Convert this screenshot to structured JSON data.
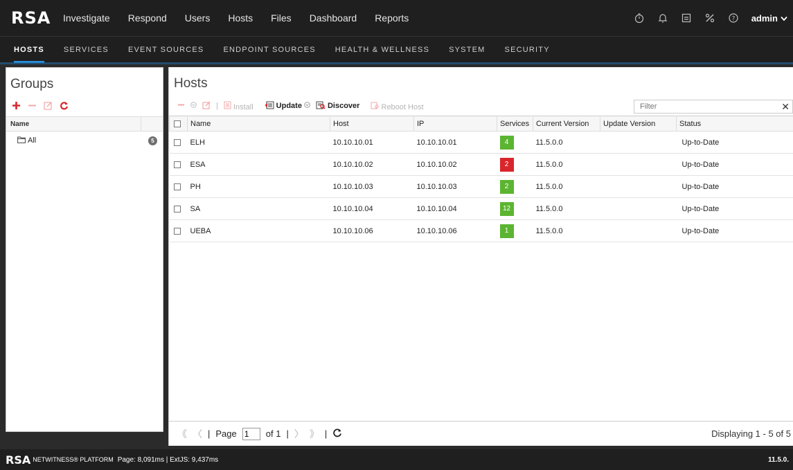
{
  "brand": "RSA",
  "topnav": [
    "Investigate",
    "Respond",
    "Users",
    "Hosts",
    "Files",
    "Dashboard",
    "Reports"
  ],
  "user": "admin",
  "subnav": [
    "HOSTS",
    "SERVICES",
    "EVENT SOURCES",
    "ENDPOINT SOURCES",
    "HEALTH & WELLNESS",
    "SYSTEM",
    "SECURITY"
  ],
  "groups": {
    "title": "Groups",
    "column": "Name",
    "items": [
      {
        "label": "All",
        "count": "5"
      }
    ]
  },
  "hosts": {
    "title": "Hosts",
    "toolbar": {
      "install": "Install",
      "update": "Update",
      "discover": "Discover",
      "reboot": "Reboot Host"
    },
    "filter_placeholder": "Filter",
    "columns": [
      "Name",
      "Host",
      "IP",
      "Services",
      "Current Version",
      "Update Version",
      "Status"
    ],
    "rows": [
      {
        "name": "ELH",
        "host": "10.10.10.01",
        "ip": "10.10.10.01",
        "services": "4",
        "svc_color": "#5cb531",
        "current": "11.5.0.0",
        "update": "",
        "status": "Up-to-Date"
      },
      {
        "name": "ESA",
        "host": "10.10.10.02",
        "ip": "10.10.10.02",
        "services": "2",
        "svc_color": "#d9262b",
        "current": "11.5.0.0",
        "update": "",
        "status": "Up-to-Date"
      },
      {
        "name": "PH",
        "host": "10.10.10.03",
        "ip": "10.10.10.03",
        "services": "2",
        "svc_color": "#5cb531",
        "current": "11.5.0.0",
        "update": "",
        "status": "Up-to-Date"
      },
      {
        "name": "SA",
        "host": "10.10.10.04",
        "ip": "10.10.10.04",
        "services": "12",
        "svc_color": "#5cb531",
        "current": "11.5.0.0",
        "update": "",
        "status": "Up-to-Date"
      },
      {
        "name": "UEBA",
        "host": "10.10.10.06",
        "ip": "10.10.10.06",
        "services": "1",
        "svc_color": "#5cb531",
        "current": "11.5.0.0",
        "update": "",
        "status": "Up-to-Date"
      }
    ],
    "paging": {
      "page_label": "Page",
      "page": "1",
      "of": "of 1",
      "display": "Displaying 1 - 5 of 5"
    }
  },
  "footer": {
    "brand": "RSA",
    "platform": "NETWITNESS® PLATFORM",
    "timing": "Page: 8,091ms | ExtJS: 9,437ms",
    "version": "11.5.0."
  }
}
